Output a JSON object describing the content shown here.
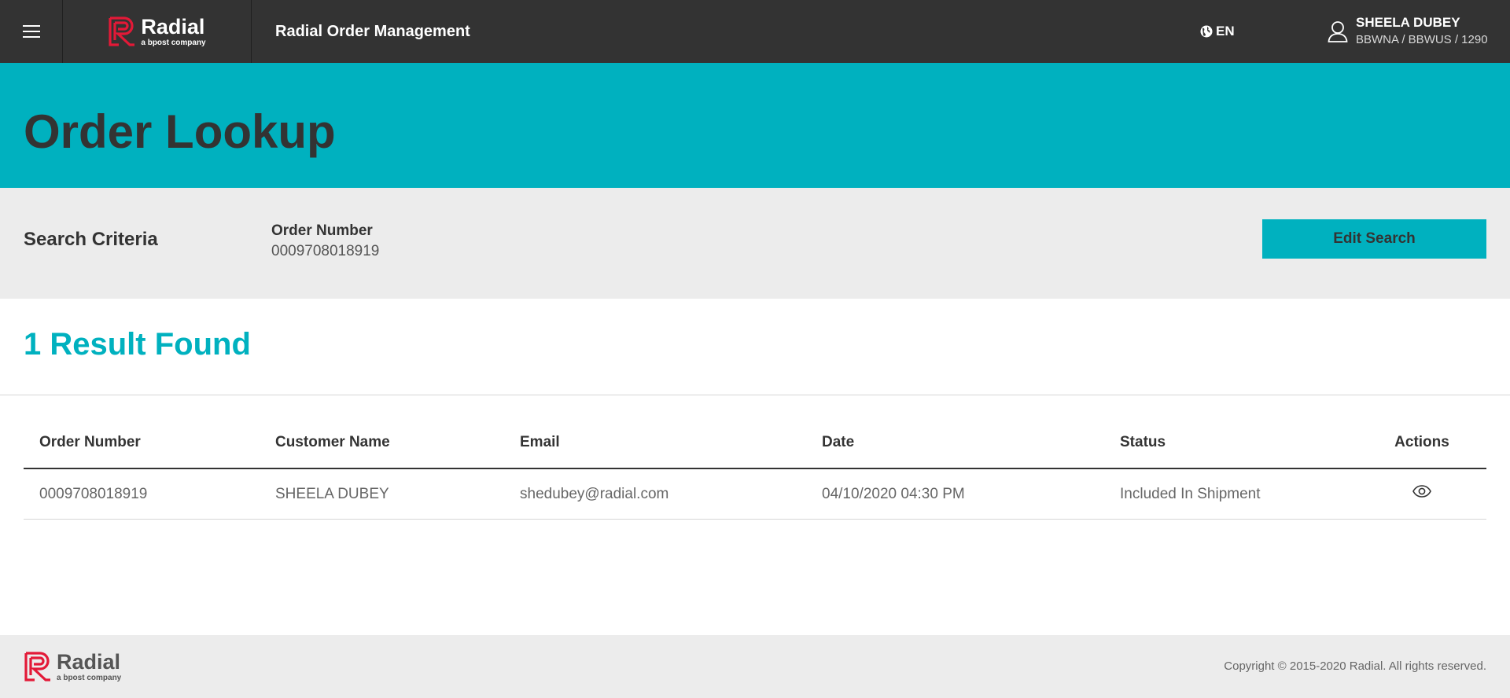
{
  "colors": {
    "topbar": "#333333",
    "accent": "#00b1bf",
    "brand_red": "#e31937",
    "panel": "#ececec"
  },
  "topbar": {
    "menu_icon": "hamburger-menu-icon",
    "brand_name": "Radial",
    "brand_tagline": "a bpost company",
    "app_title": "Radial Order Management",
    "language_icon": "globe-icon",
    "language": "EN",
    "user_icon": "user-icon",
    "user_name": "SHEELA DUBEY",
    "user_org": "BBWNA / BBWUS / 1290"
  },
  "page": {
    "title": "Order Lookup"
  },
  "search_criteria": {
    "heading": "Search Criteria",
    "field_label": "Order Number",
    "field_value": "0009708018919",
    "edit_button_label": "Edit Search"
  },
  "results": {
    "title": "1 Result Found",
    "columns": [
      "Order Number",
      "Customer Name",
      "Email",
      "Date",
      "Status",
      "Actions"
    ],
    "rows": [
      {
        "order_number": "0009708018919",
        "customer_name": "SHEELA DUBEY",
        "email": "shedubey@radial.com",
        "date": "04/10/2020 04:30 PM",
        "status": "Included In Shipment",
        "action_icon": "eye-icon"
      }
    ]
  },
  "footer": {
    "brand_name": "Radial",
    "brand_tagline": "a bpost company",
    "copyright": "Copyright © 2015-2020 Radial. All rights reserved."
  }
}
